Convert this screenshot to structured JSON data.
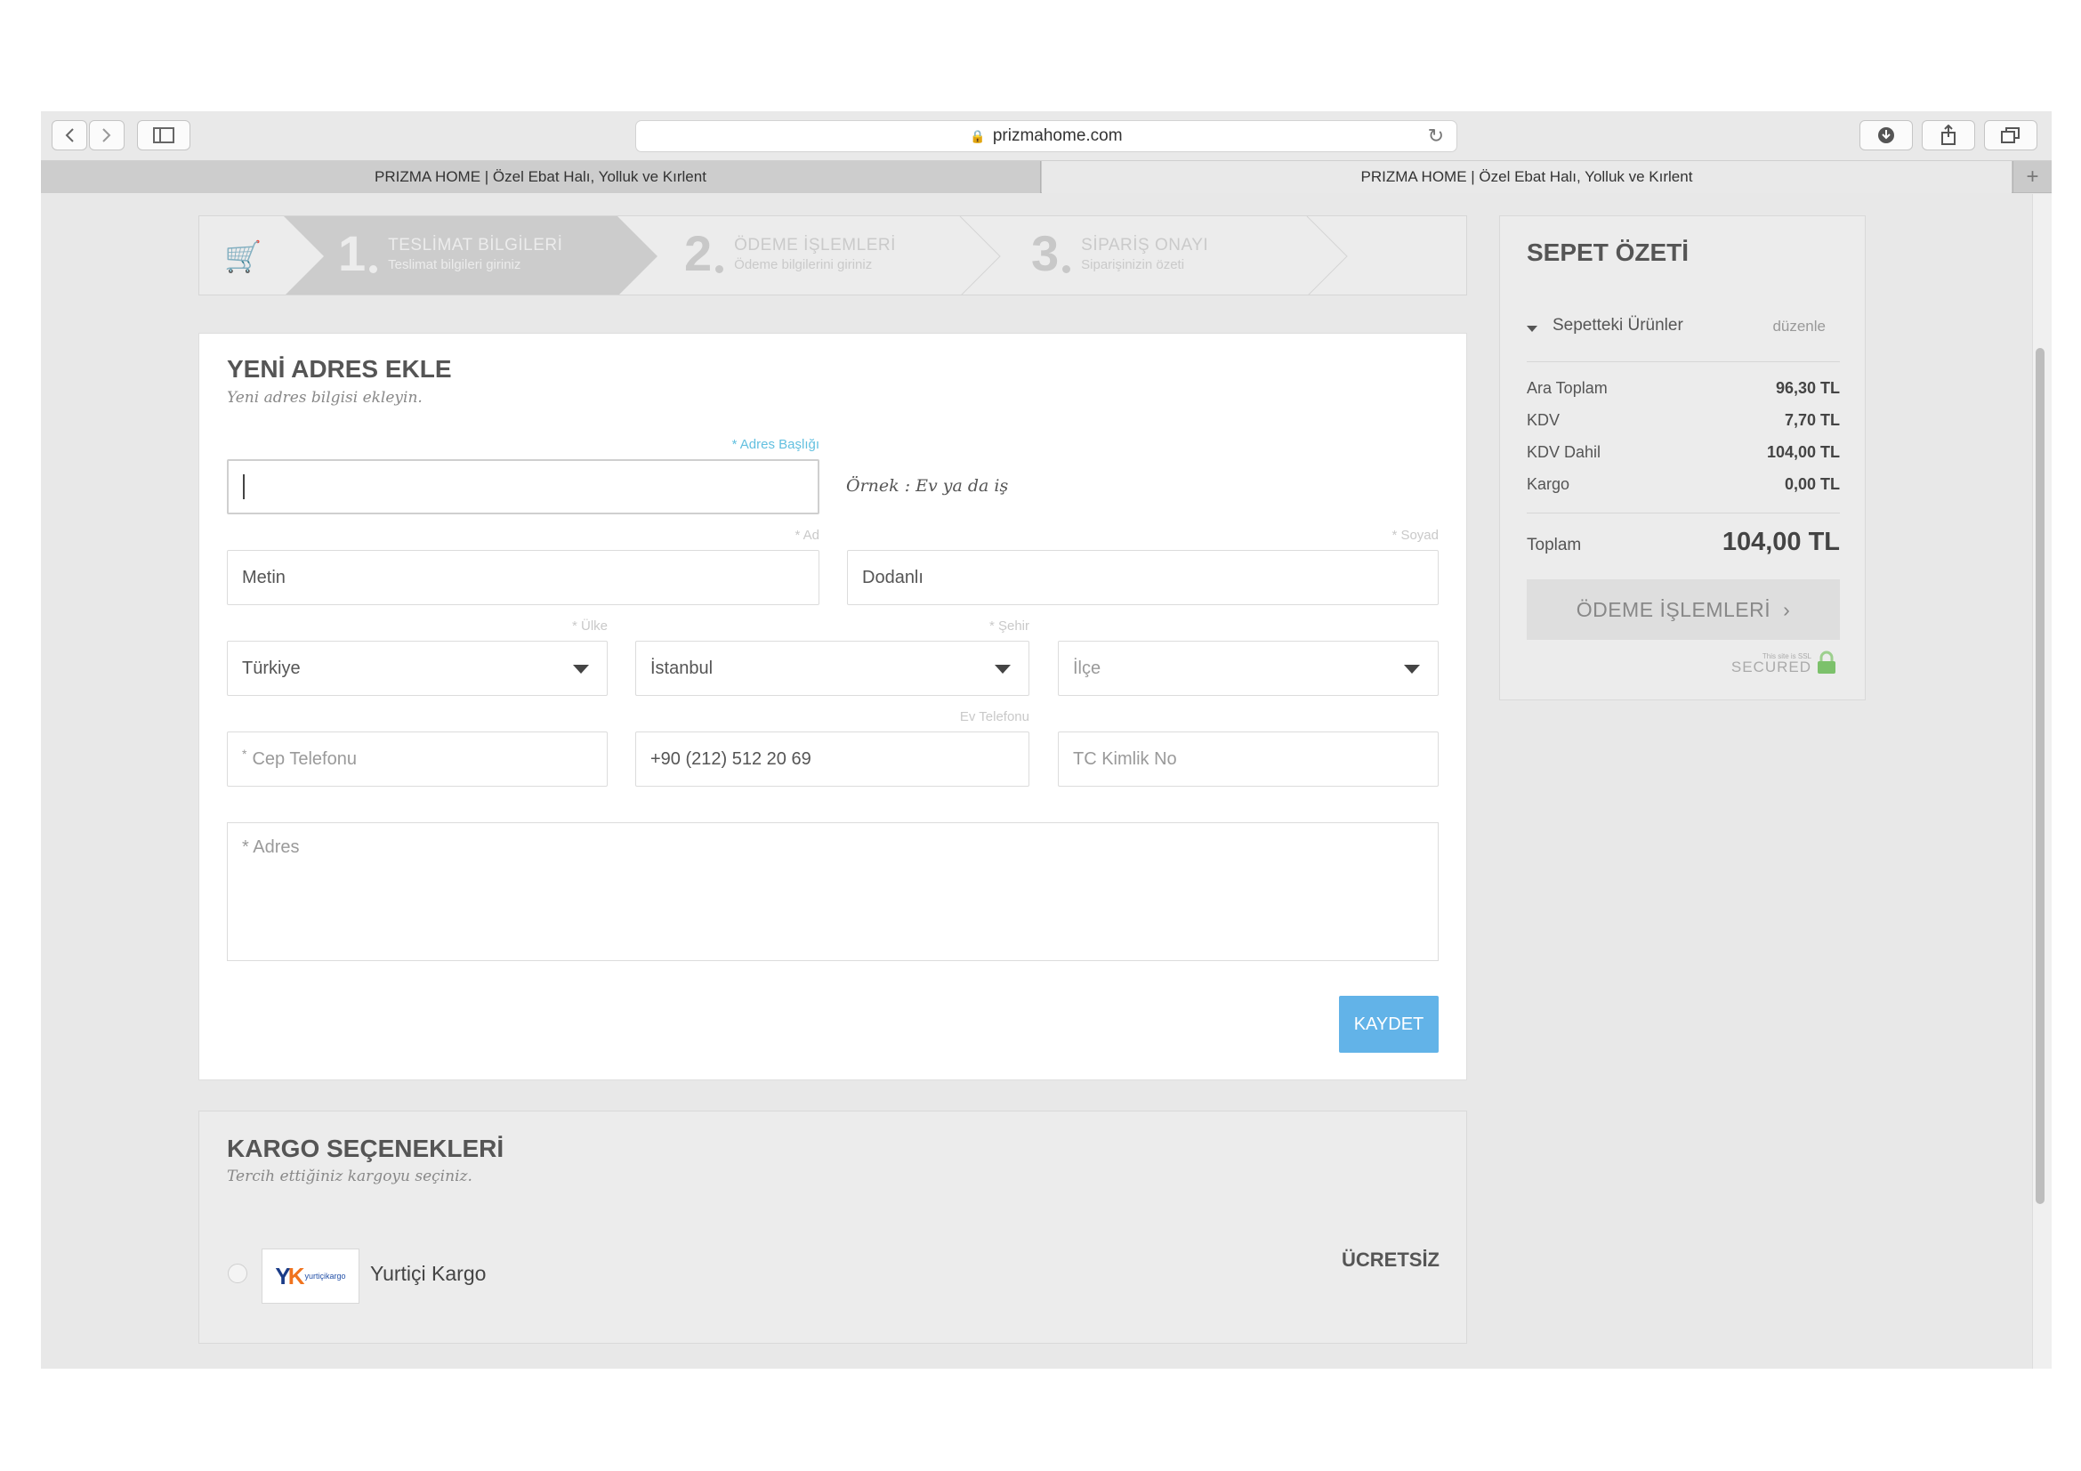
{
  "browser": {
    "url": "prizmahome.com",
    "tabs": [
      {
        "title": "PRIZMA HOME | Özel Ebat Halı, Yolluk ve Kırlent"
      },
      {
        "title": "PRIZMA HOME | Özel Ebat Halı, Yolluk ve Kırlent"
      }
    ]
  },
  "steps": [
    {
      "number": "1",
      "title": "TESLİMAT BİLGİLERİ",
      "subtitle": "Teslimat bilgileri giriniz"
    },
    {
      "number": "2",
      "title": "ÖDEME İŞLEMLERİ",
      "subtitle": "Ödeme bilgilerini giriniz"
    },
    {
      "number": "3",
      "title": "SİPARİŞ ONAYI",
      "subtitle": "Siparişinizin özeti"
    }
  ],
  "address_form": {
    "title": "YENİ ADRES EKLE",
    "subtitle": "Yeni adres bilgisi ekleyin.",
    "address_title_label": "* Adres Başlığı",
    "address_title_value": "",
    "address_title_example": "Örnek : Ev ya da iş",
    "first_name_label": "* Ad",
    "first_name_value": "Metin",
    "last_name_label": "* Soyad",
    "last_name_value": "Dodanlı",
    "country_label": "* Ülke",
    "country_value": "Türkiye",
    "city_label": "* Şehir",
    "city_value": "İstanbul",
    "district_placeholder": "İlçe",
    "mobile_placeholder": "Cep Telefonu",
    "home_phone_label": "Ev Telefonu",
    "home_phone_value": "+90 (212) 512 20 69",
    "tc_placeholder": "TC Kimlik No",
    "address_placeholder": "Adres",
    "save_label": "KAYDET"
  },
  "shipping": {
    "title": "KARGO SEÇENEKLERİ",
    "subtitle": "Tercih ettiğiniz kargoyu seçiniz.",
    "option_name": "Yurtiçi Kargo",
    "option_price": "ÜCRETSİZ",
    "logo_text": "yurtiçikargo"
  },
  "cart_summary": {
    "title": "SEPET ÖZETİ",
    "items_label": "Sepetteki Ürünler",
    "edit_label": "düzenle",
    "rows": [
      {
        "label": "Ara Toplam",
        "value": "96,30 TL"
      },
      {
        "label": "KDV",
        "value": "7,70 TL"
      },
      {
        "label": "KDV Dahil",
        "value": "104,00 TL"
      },
      {
        "label": "Kargo",
        "value": "0,00 TL"
      }
    ],
    "total_label": "Toplam",
    "total_value": "104,00 TL",
    "pay_label": "ÖDEME İŞLEMLERİ",
    "ssl_small": "This site is SSL",
    "ssl_big": "SECURED"
  },
  "colors": {
    "active_step": "#cccccc",
    "save_button": "#62b3e8",
    "required_label": "#63c0e0"
  }
}
